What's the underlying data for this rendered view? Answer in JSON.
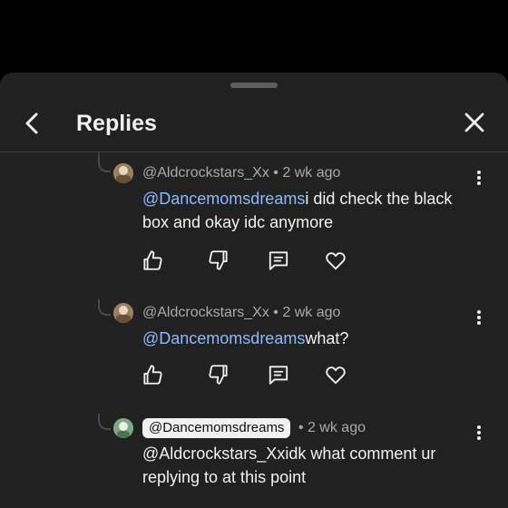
{
  "sheet": {
    "title": "Replies"
  },
  "replies": [
    {
      "author": "@Aldcrockstars_Xx",
      "separator": "•",
      "time": "2 wk ago",
      "mention": "@Dancemomsdreams",
      "text": "i did check the black box and okay idc anymore",
      "author_style": "plain"
    },
    {
      "author": "@Aldcrockstars_Xx",
      "separator": "•",
      "time": "2 wk ago",
      "mention": "@Dancemomsdreams",
      "text": "what?",
      "author_style": "plain"
    },
    {
      "author": "@Dancemomsdreams",
      "separator": "•",
      "time": "2 wk ago",
      "mention": "@Aldcrockstars_Xx",
      "text": "idk what comment ur replying to at this point",
      "author_style": "chip"
    }
  ],
  "icons": {
    "back": "chevron-left-icon",
    "close": "close-icon",
    "like": "thumbs-up-icon",
    "dislike": "thumbs-down-icon",
    "reply": "comment-icon",
    "heart": "heart-icon",
    "more": "more-vertical-icon"
  },
  "colors": {
    "background": "#000000",
    "sheet": "#212121",
    "mention": "#8fb8ff",
    "text": "#f1f1f1",
    "meta": "#aaaaaa"
  }
}
